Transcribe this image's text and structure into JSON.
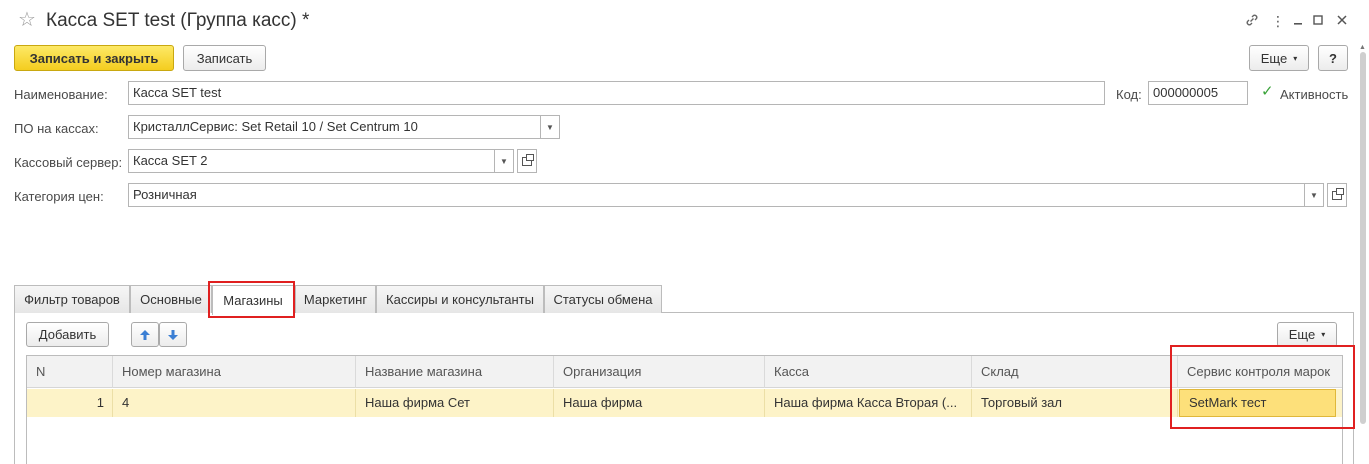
{
  "window": {
    "title": "Касса SET test (Группа касс) *",
    "favorite_icon": "star-icon",
    "link_icon": "link-icon",
    "more_icon": "more-vertical-icon",
    "minimize_icon": "minimize-icon",
    "maximize_icon": "maximize-icon",
    "close_icon": "close-icon"
  },
  "toolbar": {
    "save_close_label": "Записать и закрыть",
    "save_label": "Записать",
    "more_label": "Еще",
    "help_label": "?"
  },
  "form": {
    "name_label": "Наименование:",
    "name_value": "Касса SET test",
    "code_label": "Код:",
    "code_value": "000000005",
    "active_label": "Активность",
    "active_checked": true,
    "software_label": "ПО на кассах:",
    "software_value": "КристаллСервис: Set Retail 10 / Set Centrum 10",
    "server_label": "Кассовый сервер:",
    "server_value": "Касса SET 2",
    "price_label": "Категория цен:",
    "price_value": "Розничная"
  },
  "tabs": [
    {
      "label": "Фильтр товаров",
      "active": false
    },
    {
      "label": "Основные",
      "active": false
    },
    {
      "label": "Магазины",
      "active": true
    },
    {
      "label": "Маркетинг",
      "active": false
    },
    {
      "label": "Кассиры и консультанты",
      "active": false
    },
    {
      "label": "Статусы обмена",
      "active": false
    }
  ],
  "panel": {
    "add_label": "Добавить",
    "move_up_icon": "arrow-up-icon",
    "move_down_icon": "arrow-down-icon",
    "more_label": "Еще"
  },
  "table": {
    "columns": [
      "N",
      "Номер магазина",
      "Название магазина",
      "Организация",
      "Касса",
      "Склад",
      "Сервис контроля марок"
    ],
    "rows": [
      [
        "1",
        "4",
        "Наша фирма Сет",
        "Наша фирма",
        "Наша фирма Касса Вторая (...",
        "Торговый зал",
        "SetMark тест"
      ]
    ]
  },
  "colors": {
    "primary_button": "#f4cd1f",
    "selected_row": "#fdf3c8",
    "current_cell": "#fde07a",
    "annotation_highlight": "#e02020"
  }
}
